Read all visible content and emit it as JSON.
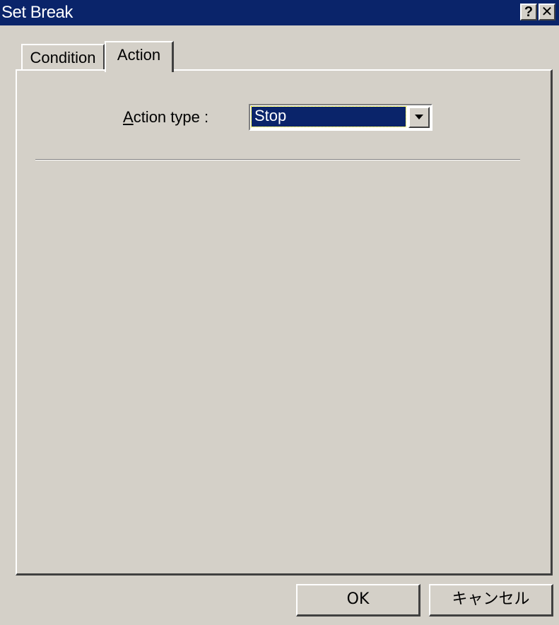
{
  "window": {
    "title": "Set Break",
    "help_button": "?",
    "close_button": "✕"
  },
  "tabs": [
    {
      "label": "Condition",
      "selected": false
    },
    {
      "label": "Action",
      "selected": true
    }
  ],
  "action_panel": {
    "action_type_label_mnemonic": "A",
    "action_type_label_rest": "ction type :",
    "action_type_value": "Stop"
  },
  "buttons": {
    "ok_label": "OK",
    "cancel_label": "キャンセル"
  },
  "colors": {
    "face": "#d4d0c8",
    "titlebar": "#0a246a",
    "selection": "#0a246a"
  }
}
